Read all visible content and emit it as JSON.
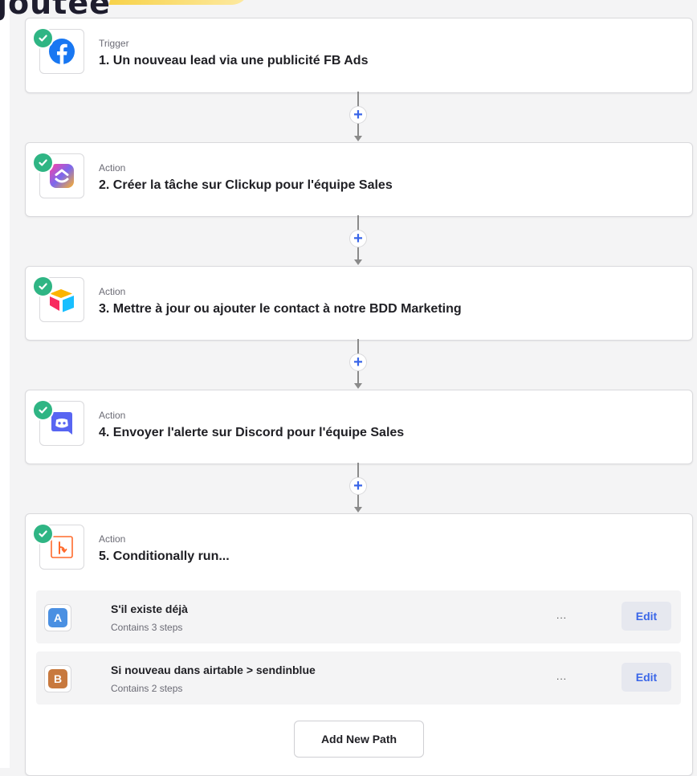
{
  "header": {
    "fragment": "joutee"
  },
  "steps": [
    {
      "type": "Trigger",
      "title": "1. Un nouveau lead via une publicité FB Ads",
      "icon": "facebook-icon"
    },
    {
      "type": "Action",
      "title": "2. Créer la tâche sur Clickup pour l'équipe Sales",
      "icon": "clickup-icon"
    },
    {
      "type": "Action",
      "title": "3. Mettre à jour ou ajouter le contact à notre BDD Marketing",
      "icon": "airtable-icon"
    },
    {
      "type": "Action",
      "title": "4. Envoyer l'alerte sur Discord pour l'équipe Sales",
      "icon": "discord-icon"
    },
    {
      "type": "Action",
      "title": "5. Conditionally run...",
      "icon": "paths-icon"
    }
  ],
  "connectors": {
    "plus_label": "+"
  },
  "paths": [
    {
      "letter": "A",
      "name": "S'il existe déjà",
      "sub": "Contains 3 steps",
      "more": "...",
      "edit": "Edit",
      "color": "#4a90e2"
    },
    {
      "letter": "B",
      "name": "Si nouveau dans airtable > sendinblue",
      "sub": "Contains 2 steps",
      "more": "...",
      "edit": "Edit",
      "color": "#c8793e"
    }
  ],
  "add_path_label": "Add New Path",
  "colors": {
    "check_green": "#2fb584",
    "accent_blue": "#3a66e8",
    "facebook_blue": "#1877f2",
    "discord_blurple": "#5865f2",
    "paths_orange": "#ff6a2c"
  }
}
